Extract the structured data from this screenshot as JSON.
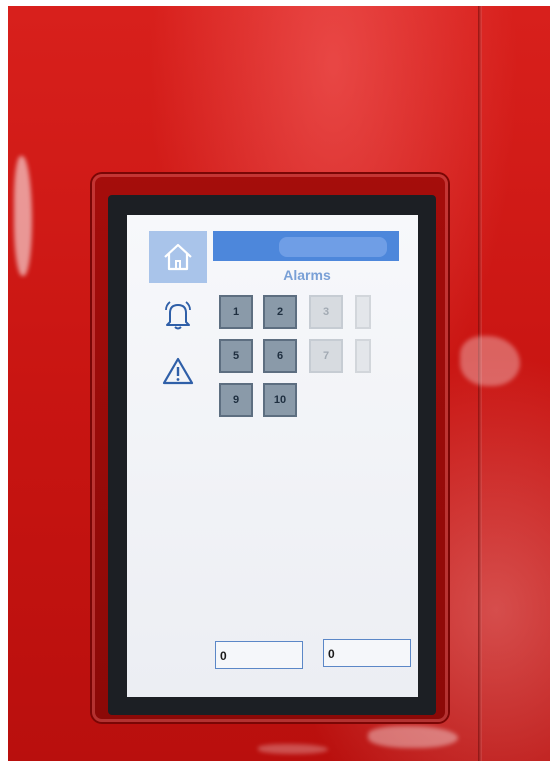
{
  "sidebar": {
    "items": [
      {
        "icon": "home-icon",
        "active": true
      },
      {
        "icon": "bell-icon",
        "active": false
      },
      {
        "icon": "warning-icon",
        "active": false
      }
    ]
  },
  "header": {
    "title": ""
  },
  "main": {
    "title": "Alarms",
    "alarm_tiles": [
      {
        "label": "1",
        "enabled": true
      },
      {
        "label": "2",
        "enabled": true
      },
      {
        "label": "3",
        "enabled": false
      },
      {
        "label": "",
        "enabled": false
      },
      {
        "label": "5",
        "enabled": true
      },
      {
        "label": "6",
        "enabled": true
      },
      {
        "label": "7",
        "enabled": false
      },
      {
        "label": "",
        "enabled": false
      },
      {
        "label": "9",
        "enabled": true
      },
      {
        "label": "10",
        "enabled": true
      }
    ],
    "counters": [
      {
        "value": "0"
      },
      {
        "value": "0"
      }
    ]
  },
  "colors": {
    "panel_red": "#c91512",
    "header_blue": "#4d87db",
    "active_tab": "#a9c4ea",
    "tile_gray": "#8a9aa9"
  }
}
